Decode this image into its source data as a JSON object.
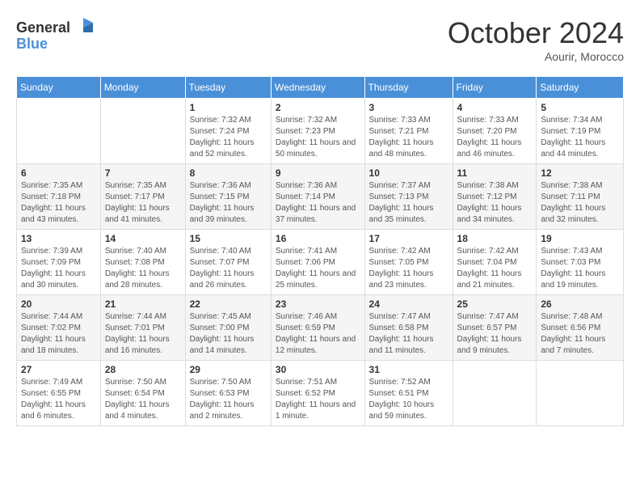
{
  "header": {
    "logo_general": "General",
    "logo_blue": "Blue",
    "month": "October 2024",
    "location": "Aourir, Morocco"
  },
  "days_of_week": [
    "Sunday",
    "Monday",
    "Tuesday",
    "Wednesday",
    "Thursday",
    "Friday",
    "Saturday"
  ],
  "weeks": [
    [
      {
        "day": "",
        "info": ""
      },
      {
        "day": "",
        "info": ""
      },
      {
        "day": "1",
        "info": "Sunrise: 7:32 AM\nSunset: 7:24 PM\nDaylight: 11 hours and 52 minutes."
      },
      {
        "day": "2",
        "info": "Sunrise: 7:32 AM\nSunset: 7:23 PM\nDaylight: 11 hours and 50 minutes."
      },
      {
        "day": "3",
        "info": "Sunrise: 7:33 AM\nSunset: 7:21 PM\nDaylight: 11 hours and 48 minutes."
      },
      {
        "day": "4",
        "info": "Sunrise: 7:33 AM\nSunset: 7:20 PM\nDaylight: 11 hours and 46 minutes."
      },
      {
        "day": "5",
        "info": "Sunrise: 7:34 AM\nSunset: 7:19 PM\nDaylight: 11 hours and 44 minutes."
      }
    ],
    [
      {
        "day": "6",
        "info": "Sunrise: 7:35 AM\nSunset: 7:18 PM\nDaylight: 11 hours and 43 minutes."
      },
      {
        "day": "7",
        "info": "Sunrise: 7:35 AM\nSunset: 7:17 PM\nDaylight: 11 hours and 41 minutes."
      },
      {
        "day": "8",
        "info": "Sunrise: 7:36 AM\nSunset: 7:15 PM\nDaylight: 11 hours and 39 minutes."
      },
      {
        "day": "9",
        "info": "Sunrise: 7:36 AM\nSunset: 7:14 PM\nDaylight: 11 hours and 37 minutes."
      },
      {
        "day": "10",
        "info": "Sunrise: 7:37 AM\nSunset: 7:13 PM\nDaylight: 11 hours and 35 minutes."
      },
      {
        "day": "11",
        "info": "Sunrise: 7:38 AM\nSunset: 7:12 PM\nDaylight: 11 hours and 34 minutes."
      },
      {
        "day": "12",
        "info": "Sunrise: 7:38 AM\nSunset: 7:11 PM\nDaylight: 11 hours and 32 minutes."
      }
    ],
    [
      {
        "day": "13",
        "info": "Sunrise: 7:39 AM\nSunset: 7:09 PM\nDaylight: 11 hours and 30 minutes."
      },
      {
        "day": "14",
        "info": "Sunrise: 7:40 AM\nSunset: 7:08 PM\nDaylight: 11 hours and 28 minutes."
      },
      {
        "day": "15",
        "info": "Sunrise: 7:40 AM\nSunset: 7:07 PM\nDaylight: 11 hours and 26 minutes."
      },
      {
        "day": "16",
        "info": "Sunrise: 7:41 AM\nSunset: 7:06 PM\nDaylight: 11 hours and 25 minutes."
      },
      {
        "day": "17",
        "info": "Sunrise: 7:42 AM\nSunset: 7:05 PM\nDaylight: 11 hours and 23 minutes."
      },
      {
        "day": "18",
        "info": "Sunrise: 7:42 AM\nSunset: 7:04 PM\nDaylight: 11 hours and 21 minutes."
      },
      {
        "day": "19",
        "info": "Sunrise: 7:43 AM\nSunset: 7:03 PM\nDaylight: 11 hours and 19 minutes."
      }
    ],
    [
      {
        "day": "20",
        "info": "Sunrise: 7:44 AM\nSunset: 7:02 PM\nDaylight: 11 hours and 18 minutes."
      },
      {
        "day": "21",
        "info": "Sunrise: 7:44 AM\nSunset: 7:01 PM\nDaylight: 11 hours and 16 minutes."
      },
      {
        "day": "22",
        "info": "Sunrise: 7:45 AM\nSunset: 7:00 PM\nDaylight: 11 hours and 14 minutes."
      },
      {
        "day": "23",
        "info": "Sunrise: 7:46 AM\nSunset: 6:59 PM\nDaylight: 11 hours and 12 minutes."
      },
      {
        "day": "24",
        "info": "Sunrise: 7:47 AM\nSunset: 6:58 PM\nDaylight: 11 hours and 11 minutes."
      },
      {
        "day": "25",
        "info": "Sunrise: 7:47 AM\nSunset: 6:57 PM\nDaylight: 11 hours and 9 minutes."
      },
      {
        "day": "26",
        "info": "Sunrise: 7:48 AM\nSunset: 6:56 PM\nDaylight: 11 hours and 7 minutes."
      }
    ],
    [
      {
        "day": "27",
        "info": "Sunrise: 7:49 AM\nSunset: 6:55 PM\nDaylight: 11 hours and 6 minutes."
      },
      {
        "day": "28",
        "info": "Sunrise: 7:50 AM\nSunset: 6:54 PM\nDaylight: 11 hours and 4 minutes."
      },
      {
        "day": "29",
        "info": "Sunrise: 7:50 AM\nSunset: 6:53 PM\nDaylight: 11 hours and 2 minutes."
      },
      {
        "day": "30",
        "info": "Sunrise: 7:51 AM\nSunset: 6:52 PM\nDaylight: 11 hours and 1 minute."
      },
      {
        "day": "31",
        "info": "Sunrise: 7:52 AM\nSunset: 6:51 PM\nDaylight: 10 hours and 59 minutes."
      },
      {
        "day": "",
        "info": ""
      },
      {
        "day": "",
        "info": ""
      }
    ]
  ]
}
